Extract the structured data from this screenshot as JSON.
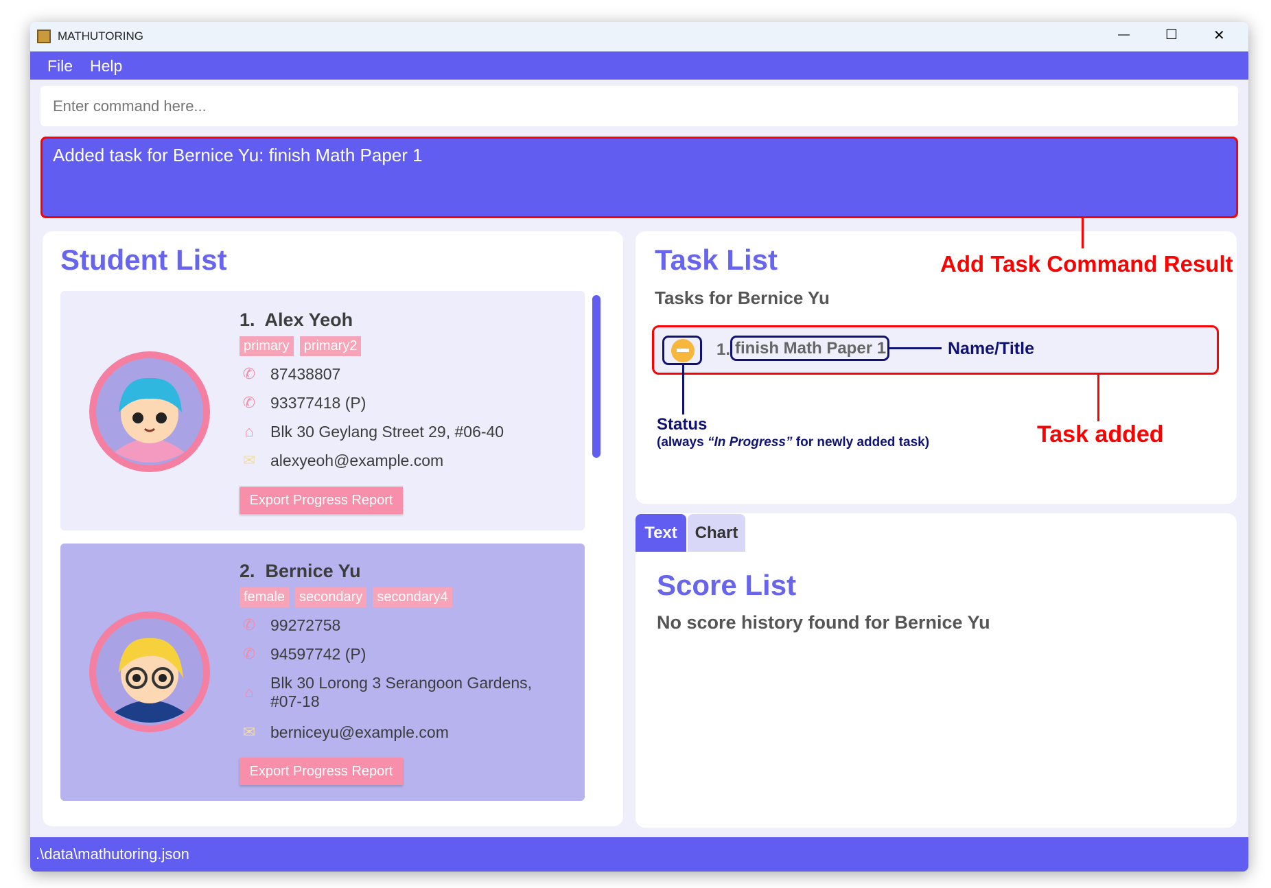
{
  "window": {
    "title": "MATHUTORING",
    "minimize": "—",
    "maximize": "☐",
    "close": "✕"
  },
  "menu": {
    "file": "File",
    "help": "Help"
  },
  "command": {
    "placeholder": "Enter command here...",
    "value": ""
  },
  "result": {
    "text": "Added task for Bernice Yu: finish Math Paper 1"
  },
  "students": {
    "title": "Student List",
    "items": [
      {
        "index": "1.",
        "name": "Alex Yeoh",
        "tags": [
          "primary",
          "primary2"
        ],
        "phone": "87438807",
        "parent_phone": "93377418 (P)",
        "address": "Blk 30 Geylang Street 29, #06-40",
        "email": "alexyeoh@example.com",
        "button": "Export Progress Report"
      },
      {
        "index": "2.",
        "name": "Bernice Yu",
        "tags": [
          "female",
          "secondary",
          "secondary4"
        ],
        "phone": "99272758",
        "parent_phone": "94597742 (P)",
        "address": "Blk 30 Lorong 3 Serangoon Gardens,",
        "address2": "#07-18",
        "email": "berniceyu@example.com",
        "button": "Export Progress Report"
      }
    ]
  },
  "tasks": {
    "title": "Task List",
    "subtitle": "Tasks for Bernice Yu",
    "items": [
      {
        "index": "1.",
        "name": "finish Math Paper 1",
        "status": "In Progress"
      }
    ]
  },
  "annotations": {
    "command_result": "Add Task Command Result",
    "name_title": "Name/Title",
    "status": "Status",
    "status_note_pre": "(always ",
    "status_note_em": "“In Progress”",
    "status_note_post": " for newly added task)",
    "task_added": "Task added"
  },
  "scores": {
    "tabs": [
      "Text",
      "Chart"
    ],
    "active_tab": "Text",
    "title": "Score List",
    "empty": "No score history found for Bernice Yu"
  },
  "statusbar": {
    "path": ".\\data\\mathutoring.json"
  },
  "colors": {
    "accent": "#605df0",
    "tag": "#f7a3b8",
    "button": "#f78fab",
    "status_in_progress": "#f6b73c",
    "annotation_red": "#ff0000",
    "annotation_navy": "#0f1272"
  }
}
